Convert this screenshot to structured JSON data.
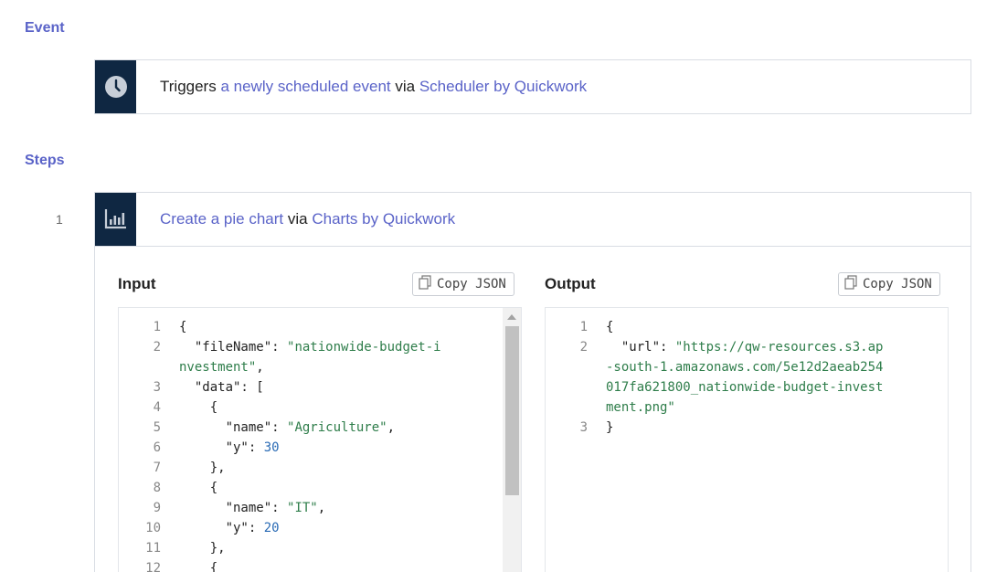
{
  "event": {
    "section_title": "Event",
    "icon": "clock-icon",
    "prefix": "Triggers",
    "trigger_link": "a newly scheduled event",
    "via": "via",
    "app_link": "Scheduler by Quickwork"
  },
  "steps": {
    "section_title": "Steps",
    "items": [
      {
        "number": "1",
        "icon": "bar-chart-icon",
        "action_link": "Create a pie chart",
        "via": "via",
        "app_link": "Charts by Quickwork"
      }
    ]
  },
  "input": {
    "title": "Input",
    "copy_label": "Copy JSON",
    "lines": [
      {
        "num": "1",
        "parts": [
          {
            "t": "{",
            "c": "k"
          }
        ]
      },
      {
        "num": "2",
        "parts": [
          {
            "t": "  \"fileName\": ",
            "c": "k"
          },
          {
            "t": "\"nationwide-budget-i",
            "c": "s"
          }
        ]
      },
      {
        "num": "",
        "parts": [
          {
            "t": "nvestment\"",
            "c": "s"
          },
          {
            "t": ",",
            "c": "k"
          }
        ]
      },
      {
        "num": "3",
        "parts": [
          {
            "t": "  \"data\": [",
            "c": "k"
          }
        ]
      },
      {
        "num": "4",
        "parts": [
          {
            "t": "    {",
            "c": "k"
          }
        ]
      },
      {
        "num": "5",
        "parts": [
          {
            "t": "      \"name\": ",
            "c": "k"
          },
          {
            "t": "\"Agriculture\"",
            "c": "s"
          },
          {
            "t": ",",
            "c": "k"
          }
        ]
      },
      {
        "num": "6",
        "parts": [
          {
            "t": "      \"y\": ",
            "c": "k"
          },
          {
            "t": "30",
            "c": "n"
          }
        ]
      },
      {
        "num": "7",
        "parts": [
          {
            "t": "    },",
            "c": "k"
          }
        ]
      },
      {
        "num": "8",
        "parts": [
          {
            "t": "    {",
            "c": "k"
          }
        ]
      },
      {
        "num": "9",
        "parts": [
          {
            "t": "      \"name\": ",
            "c": "k"
          },
          {
            "t": "\"IT\"",
            "c": "s"
          },
          {
            "t": ",",
            "c": "k"
          }
        ]
      },
      {
        "num": "10",
        "parts": [
          {
            "t": "      \"y\": ",
            "c": "k"
          },
          {
            "t": "20",
            "c": "n"
          }
        ]
      },
      {
        "num": "11",
        "parts": [
          {
            "t": "    },",
            "c": "k"
          }
        ]
      },
      {
        "num": "12",
        "parts": [
          {
            "t": "    {",
            "c": "k"
          }
        ]
      }
    ]
  },
  "output": {
    "title": "Output",
    "copy_label": "Copy JSON",
    "lines": [
      {
        "num": "1",
        "parts": [
          {
            "t": "{",
            "c": "k"
          }
        ]
      },
      {
        "num": "2",
        "parts": [
          {
            "t": "  \"url\": ",
            "c": "k"
          },
          {
            "t": "\"https://qw-resources.s3.ap",
            "c": "s"
          }
        ]
      },
      {
        "num": "",
        "parts": [
          {
            "t": "-south-1.amazonaws.com/5e12d2aeab254",
            "c": "s"
          }
        ]
      },
      {
        "num": "",
        "parts": [
          {
            "t": "017fa621800_nationwide-budget-invest",
            "c": "s"
          }
        ]
      },
      {
        "num": "",
        "parts": [
          {
            "t": "ment.png\"",
            "c": "s"
          }
        ]
      },
      {
        "num": "3",
        "parts": [
          {
            "t": "}",
            "c": "k"
          }
        ]
      }
    ]
  },
  "colors": {
    "accent": "#5a63c8",
    "icon_bg": "#0f2742",
    "string": "#2e7d4a",
    "number": "#2a6bb5"
  }
}
